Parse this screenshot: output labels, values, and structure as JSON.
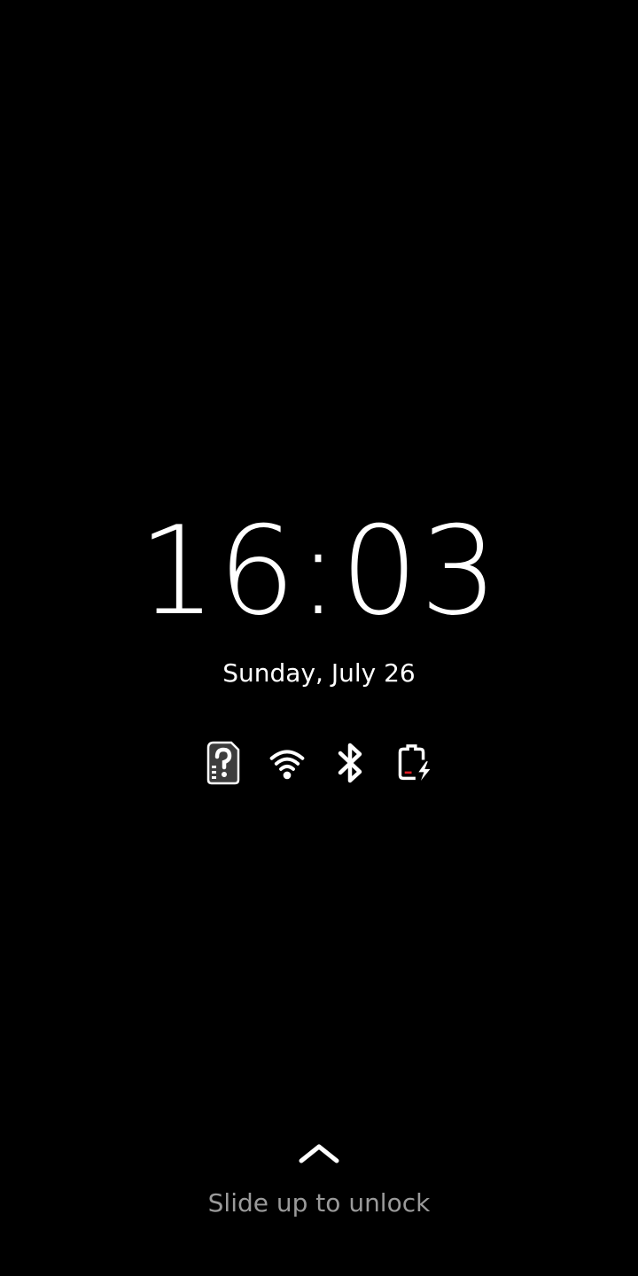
{
  "lockscreen": {
    "time": "16:03",
    "date": "Sunday, July 26",
    "unlock_hint": "Slide up to unlock"
  },
  "status_icons": [
    {
      "name": "sim-unknown-icon",
      "state": "no SIM / unknown"
    },
    {
      "name": "wifi-icon",
      "state": "connected"
    },
    {
      "name": "bluetooth-icon",
      "state": "on"
    },
    {
      "name": "battery-charging-icon",
      "state": "charging, low"
    }
  ],
  "colors": {
    "background": "#000000",
    "text": "#ffffff",
    "hint_text": "#9a9a9a",
    "battery_low": "#e01b24",
    "sim_fill": "#3d3d3d"
  }
}
